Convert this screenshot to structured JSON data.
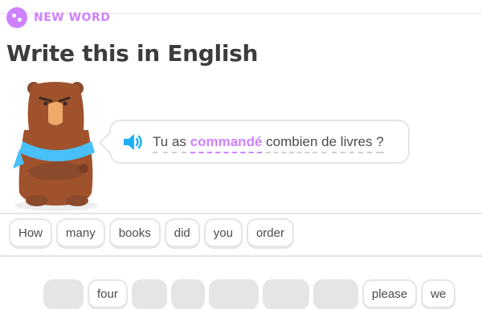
{
  "header": {
    "badge_label": "NEW WORD"
  },
  "title": "Write this in English",
  "prompt": {
    "words": [
      {
        "text": "Tu",
        "highlight": false
      },
      {
        "text": "as",
        "highlight": false
      },
      {
        "text": "commandé",
        "highlight": true
      },
      {
        "text": "combien",
        "highlight": false
      },
      {
        "text": "de",
        "highlight": false
      },
      {
        "text": "livres",
        "highlight": false
      },
      {
        "text": "?",
        "highlight": false
      }
    ]
  },
  "answer_tiles": [
    "How",
    "many",
    "books",
    "did",
    "you",
    "order"
  ],
  "word_bank": [
    {
      "label": "",
      "used": true
    },
    {
      "label": "four",
      "used": false
    },
    {
      "label": "",
      "used": true
    },
    {
      "label": "",
      "used": true
    },
    {
      "label": "",
      "used": true
    },
    {
      "label": "",
      "used": true
    },
    {
      "label": "",
      "used": true
    },
    {
      "label": "please",
      "used": false
    },
    {
      "label": "we",
      "used": false
    }
  ],
  "colors": {
    "accent": "#ce82ff",
    "speaker": "#1cb0f6",
    "tile_border": "#e5e5e5",
    "bear_fur": "#a0522d",
    "scarf": "#49c0f8"
  }
}
